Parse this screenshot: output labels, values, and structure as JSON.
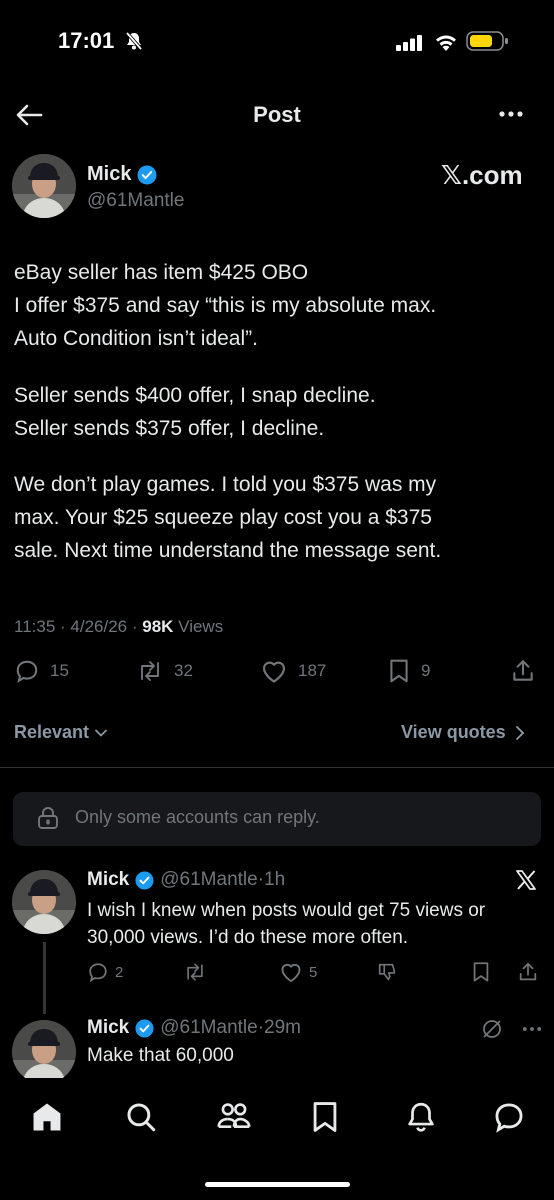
{
  "status_bar": {
    "time": "17:01"
  },
  "header": {
    "title": "Post"
  },
  "post": {
    "author_name": "Mick",
    "author_handle": "@61Mantle",
    "brand": "𝕏.com",
    "paragraphs": [
      [
        "eBay seller has item $425 OBO",
        "I offer $375 and say “this is my absolute max.",
        "Auto Condition isn’t ideal”."
      ],
      [
        "Seller sends $400 offer, I snap decline.",
        "Seller sends $375 offer, I decline."
      ],
      [
        "We don’t play games. I told you $375 was my",
        "max. Your $25 squeeze play cost you a $375",
        "sale. Next time understand the message sent."
      ]
    ],
    "time": "11:35",
    "date": "4/26/26",
    "views_count": "98K",
    "views_label": "Views",
    "actions": {
      "replies": "15",
      "reposts": "32",
      "likes": "187",
      "bookmarks": "9"
    }
  },
  "filters": {
    "sort_label": "Relevant",
    "view_quotes_label": "View quotes"
  },
  "reply_restriction": "Only some accounts can reply.",
  "replies": [
    {
      "name": "Mick",
      "handle": "@61Mantle",
      "time": "1h",
      "text": "I wish I knew when posts would get 75 views or 30,000 views. I’d do these more often.",
      "replies": "2",
      "likes": "5"
    },
    {
      "name": "Mick",
      "handle": "@61Mantle",
      "time": "29m",
      "text": "Make that 60,000"
    }
  ],
  "colors": {
    "background": "#000000",
    "text": "#e7e9ea",
    "muted": "#71767b",
    "verified": "#1d9bf0",
    "battery": "#ffd60a"
  },
  "icons": [
    "back-arrow-icon",
    "more-icon",
    "verified-badge-icon",
    "reply-icon",
    "repost-icon",
    "like-icon",
    "bookmark-icon",
    "share-icon",
    "lock-icon",
    "x-logo-icon",
    "home-icon",
    "search-icon",
    "communities-icon",
    "bookmarks-nav-icon",
    "notifications-icon",
    "messages-icon"
  ]
}
